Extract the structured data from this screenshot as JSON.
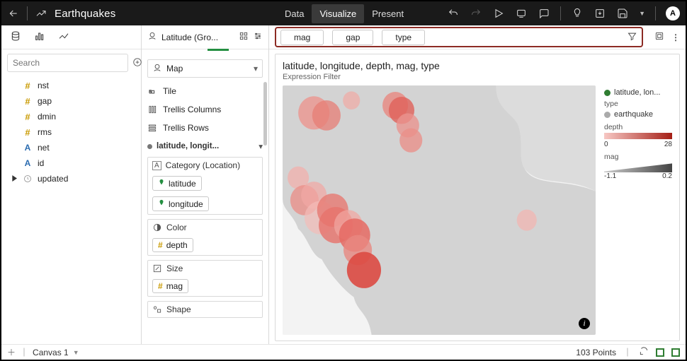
{
  "header": {
    "title": "Earthquakes",
    "tabs": [
      {
        "label": "Data",
        "active": false
      },
      {
        "label": "Visualize",
        "active": true
      },
      {
        "label": "Present",
        "active": false
      }
    ],
    "avatar_initial": "A"
  },
  "sidebar": {
    "search_placeholder": "Search",
    "fields": [
      {
        "label": "nst",
        "type": "hash"
      },
      {
        "label": "gap",
        "type": "hash"
      },
      {
        "label": "dmin",
        "type": "hash"
      },
      {
        "label": "rms",
        "type": "hash"
      },
      {
        "label": "net",
        "type": "letter"
      },
      {
        "label": "id",
        "type": "letter"
      },
      {
        "label": "updated",
        "type": "clock",
        "expandable": true
      }
    ]
  },
  "shelf": {
    "title": "Latitude (Gro...",
    "viz_type": "Map",
    "drops": [
      {
        "label": "Tile",
        "icon": "tile"
      },
      {
        "label": "Trellis Columns",
        "icon": "tcols"
      },
      {
        "label": "Trellis Rows",
        "icon": "trows"
      }
    ],
    "layer_title": "latitude, longit...",
    "category_label": "Category (Location)",
    "category_pills": [
      "latitude",
      "longitude"
    ],
    "color_label": "Color",
    "color_pill": "depth",
    "size_label": "Size",
    "size_pill": "mag",
    "shape_label": "Shape"
  },
  "filters": {
    "pills": [
      "mag",
      "gap",
      "type"
    ]
  },
  "viz": {
    "title": "latitude, longitude, depth, mag, type",
    "subtitle": "Expression Filter",
    "legend": {
      "layer": "latitude, lon...",
      "type_label": "type",
      "type_value": "earthquake",
      "depth_label": "depth",
      "depth_min": "0",
      "depth_max": "28",
      "mag_label": "mag",
      "mag_min": "-1.1",
      "mag_max": "0.2"
    }
  },
  "bottom": {
    "canvas_label": "Canvas 1",
    "points_label": "103 Points"
  },
  "chart_data": {
    "type": "scatter",
    "note": "positions in percent of map box; r is radius px",
    "points": [
      {
        "x": 10,
        "y": 11,
        "r": 22,
        "fill": "#ed928b",
        "op": 0.75
      },
      {
        "x": 14,
        "y": 12,
        "r": 20,
        "fill": "#e77d76",
        "op": 0.75
      },
      {
        "x": 22,
        "y": 6,
        "r": 12,
        "fill": "#f1a9a4",
        "op": 0.7
      },
      {
        "x": 36,
        "y": 8,
        "r": 18,
        "fill": "#e98881",
        "op": 0.8
      },
      {
        "x": 38,
        "y": 10,
        "r": 18,
        "fill": "#e0615a",
        "op": 0.8
      },
      {
        "x": 40,
        "y": 16,
        "r": 16,
        "fill": "#eb948e",
        "op": 0.78
      },
      {
        "x": 41,
        "y": 22,
        "r": 16,
        "fill": "#ea8f89",
        "op": 0.78
      },
      {
        "x": 5,
        "y": 37,
        "r": 15,
        "fill": "#f2afab",
        "op": 0.72
      },
      {
        "x": 7,
        "y": 46,
        "r": 20,
        "fill": "#ea8f89",
        "op": 0.78
      },
      {
        "x": 10,
        "y": 44,
        "r": 18,
        "fill": "#f1a8a3",
        "op": 0.72
      },
      {
        "x": 12,
        "y": 53,
        "r": 22,
        "fill": "#f4bcb8",
        "op": 0.7
      },
      {
        "x": 16,
        "y": 50,
        "r": 22,
        "fill": "#e77b74",
        "op": 0.82
      },
      {
        "x": 17,
        "y": 56,
        "r": 24,
        "fill": "#e6746d",
        "op": 0.82
      },
      {
        "x": 21,
        "y": 56,
        "r": 20,
        "fill": "#f1a6a1",
        "op": 0.72
      },
      {
        "x": 23,
        "y": 60,
        "r": 22,
        "fill": "#e56a63",
        "op": 0.85
      },
      {
        "x": 24,
        "y": 66,
        "r": 20,
        "fill": "#e98881",
        "op": 0.8
      },
      {
        "x": 26,
        "y": 74,
        "r": 24,
        "fill": "#dc4a43",
        "op": 0.9
      },
      {
        "x": 78,
        "y": 54,
        "r": 14,
        "fill": "#f3b4af",
        "op": 0.7
      }
    ]
  }
}
